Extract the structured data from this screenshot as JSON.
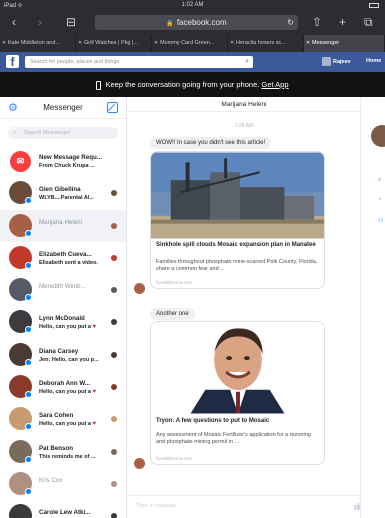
{
  "status": {
    "carrier": "iPad ≎",
    "time": "1:02 AM"
  },
  "toolbar": {
    "back": "‹",
    "forward": "›",
    "bookmarks": "⊟",
    "share": "⇧",
    "new_tab": "+",
    "tabs": "⧉"
  },
  "url": {
    "host": "facebook.com",
    "lock": "🔒",
    "reload": "↻"
  },
  "tabs": [
    {
      "label": "Kate Middleton and...",
      "active": false
    },
    {
      "label": "Grill Watches | Pkg |...",
      "active": false
    },
    {
      "label": "Mommy Card Green...",
      "active": false
    },
    {
      "label": "Heraclia hosers sc...",
      "active": false
    },
    {
      "label": "Messenger",
      "active": true
    }
  ],
  "fb": {
    "logo": "f",
    "search_placeholder": "Search for people, places and things",
    "user": "Rajeev",
    "home": "Home"
  },
  "banner": {
    "text": "Keep the conversation going from your phone.",
    "link": "Get App"
  },
  "sidebar": {
    "title": "Messenger",
    "search_placeholder": "Search Messenger",
    "items": [
      {
        "name": "New Message Requ...",
        "snippet": "From Chuck Krupa ...",
        "color": "#fa3e3e",
        "read": false,
        "type": "request"
      },
      {
        "name": "Glen Gibellina",
        "snippet": "WLYB....Parental Al...",
        "color": "#6b4b3a",
        "read": false
      },
      {
        "name": "Marijana Heleni",
        "snippet": "",
        "color": "#a76046",
        "read": true,
        "selected": true
      },
      {
        "name": "Elizabeth Cueva...",
        "snippet": "Elizabeth sent a video.",
        "color": "#c0392b",
        "read": false
      },
      {
        "name": "Meredith Wimb...",
        "snippet": "",
        "color": "#555a66",
        "read": true
      },
      {
        "name": "Lynn McDonald",
        "snippet": "Hello, can you put a",
        "color": "#3d3a40",
        "read": false,
        "heart": "♥"
      },
      {
        "name": "Diana Carsey",
        "snippet": "Jen: Hello, can you p...",
        "color": "#4a3a35",
        "read": false
      },
      {
        "name": "Deborah Ann W...",
        "snippet": "Hello, can you put a",
        "color": "#8a3a2a",
        "read": false,
        "heart": "♥"
      },
      {
        "name": "Sara Cohen",
        "snippet": "Hello, can you put a",
        "color": "#c89a70",
        "read": false,
        "heart": "♥"
      },
      {
        "name": "Pat Benson",
        "snippet": "This reminds me of ...",
        "color": "#7a6a5a",
        "read": false
      },
      {
        "name": "Kris Cox",
        "snippet": "",
        "color": "#b09080",
        "read": true
      },
      {
        "name": "Carole Lew Atki...",
        "snippet": "",
        "color": "#3a3a3a",
        "read": false
      }
    ]
  },
  "conversation": {
    "title": "Marijana Heleni",
    "timestamp": "1:26 AM",
    "msg1": "WOW!! In case you didn't see this article!",
    "card1": {
      "headline": "Sinkhole spill clouds Mosaic expansion plan in Manatee",
      "desc": "Families throughout phosphate mine-scarred Polk County, Florida, share a common fear and ...",
      "source": "heraldtribune.com"
    },
    "msg2": "Another one",
    "card2": {
      "headline": "Tryon: A few questions to put to Mosaic",
      "desc": "Any assessment of Mosaic Fertilizer's application for a rezoning and phosphate-mining permit in ...",
      "source": "heraldtribune.com"
    },
    "composer_placeholder": "Type a message..."
  },
  "colors": {
    "fb_blue": "#3b5998",
    "messenger_blue": "#0084ff",
    "chrome": "#2c2d31"
  }
}
